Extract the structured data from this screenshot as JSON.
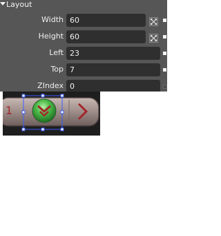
{
  "panel": {
    "section_title": "Layout",
    "properties": [
      {
        "label": "Width",
        "value": "60"
      },
      {
        "label": "Height",
        "value": "60"
      },
      {
        "label": "Left",
        "value": "23"
      },
      {
        "label": "Top",
        "value": "7"
      },
      {
        "label": "ZIndex",
        "value": "0"
      }
    ]
  },
  "canvas": {
    "left_glyph": "1",
    "icons": {
      "autosize": "expand-arrows-icon",
      "center_button": "chevron-down-icon",
      "right_button": "chevron-right-icon"
    }
  },
  "colors": {
    "panel_bg": "#565656",
    "input_bg": "#2f2f2f",
    "canvas_bg": "#1e1e1e",
    "selection": "#3b5cff",
    "accent_red": "#a3262a",
    "button_green": "#3ca23c"
  }
}
